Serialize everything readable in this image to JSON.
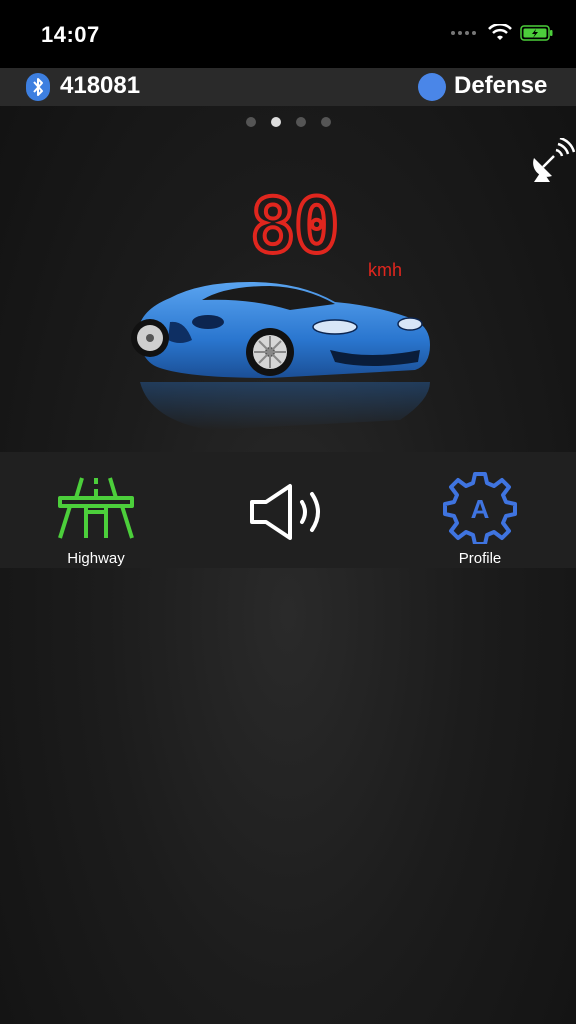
{
  "status_bar": {
    "time": "14:07"
  },
  "header": {
    "device_id": "418081",
    "mode": "Defense"
  },
  "pager": {
    "pages": 4,
    "active_index": 1
  },
  "speed": {
    "value": "80",
    "unit": "kmh"
  },
  "controls": {
    "highway_label": "Highway",
    "profile_label": "Profile",
    "profile_badge": "A"
  },
  "colors": {
    "speed": "#e0261e",
    "highway": "#4ccf3b",
    "profile": "#3f74e0",
    "mode_dot": "#4a86e8",
    "car": "#2f7ed3"
  }
}
